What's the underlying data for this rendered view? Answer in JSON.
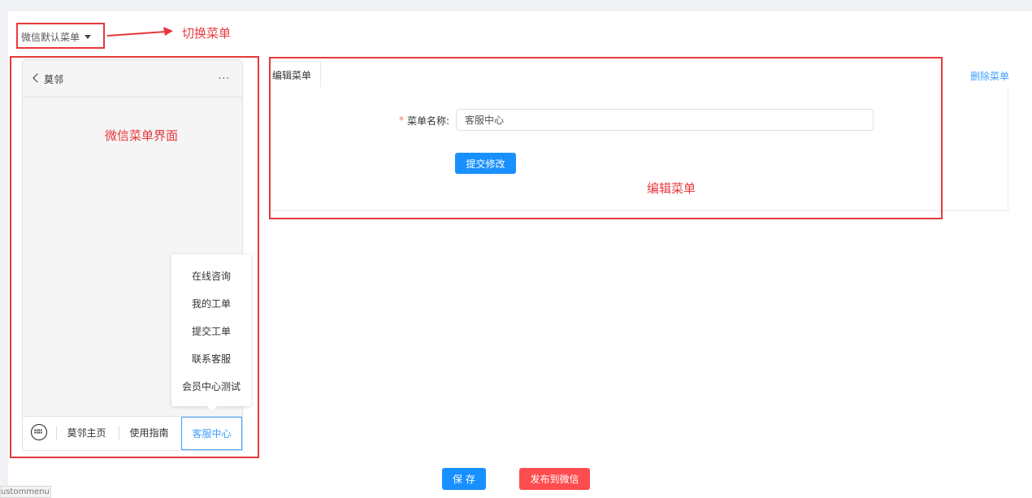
{
  "menu_select": {
    "value": "微信默认菜单"
  },
  "annotations": {
    "switch_menu": "切换菜单",
    "wechat_ui": "微信菜单界面",
    "edit_menu": "编辑菜单"
  },
  "phone": {
    "title": "莫邻",
    "more": "...",
    "submenu": [
      "在线咨询",
      "我的工单",
      "提交工单",
      "联系客服",
      "会员中心测试"
    ],
    "tabs": [
      "莫邻主页",
      "使用指南",
      "客服中心"
    ],
    "active_tab": "客服中心"
  },
  "editor": {
    "tab_label": "编辑菜单",
    "delete_label": "删除菜单",
    "required_mark": "*",
    "name_label": "菜单名称:",
    "name_value": "客服中心",
    "submit_label": "提交修改"
  },
  "footer": {
    "save_label": "保 存",
    "publish_label": "发布到微信"
  },
  "bottom_tag": "ustommenu",
  "colors": {
    "annotation": "#e8383d",
    "primary": "#1890ff",
    "danger": "#ff4d4f",
    "link": "#409eff"
  }
}
